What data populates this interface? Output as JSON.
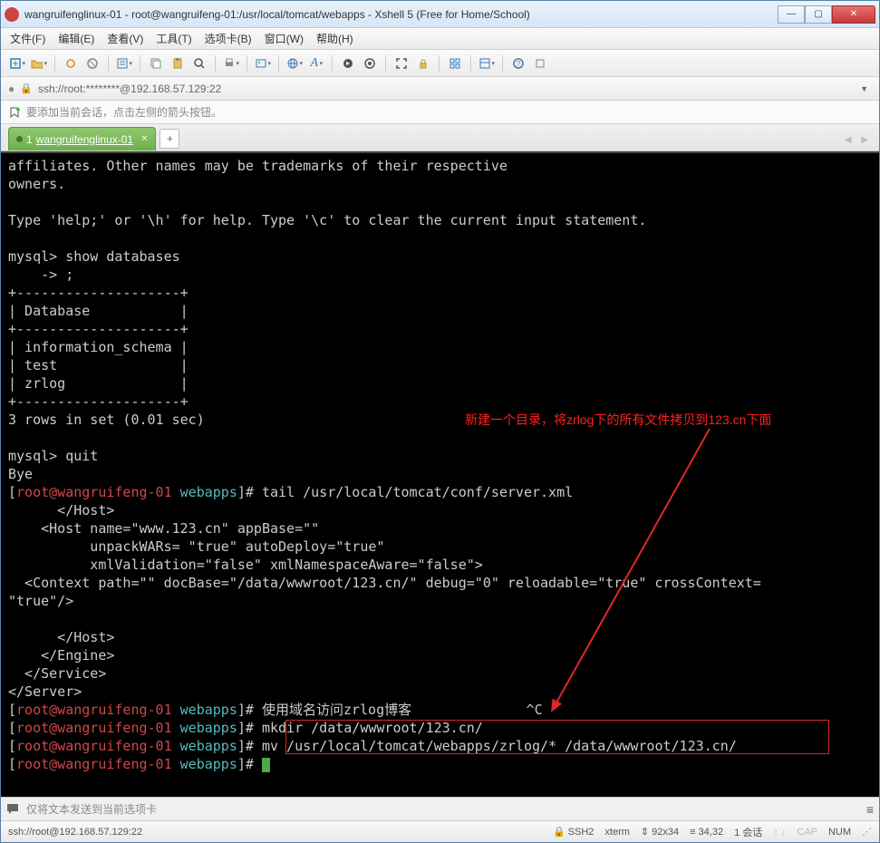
{
  "window": {
    "title": "wangruifenglinux-01 - root@wangruifeng-01:/usr/local/tomcat/webapps - Xshell 5 (Free for Home/School)"
  },
  "menu": {
    "file": "文件(F)",
    "edit": "编辑(E)",
    "view": "查看(V)",
    "tools": "工具(T)",
    "tabs": "选项卡(B)",
    "window": "窗口(W)",
    "help": "帮助(H)"
  },
  "addressbar": {
    "url": "ssh://root:********@192.168.57.129:22"
  },
  "hint": {
    "text": "要添加当前会话，点击左侧的箭头按钮。"
  },
  "tab": {
    "index": "1",
    "label": "wangruifenglinux-01"
  },
  "terminal": {
    "lines": [
      "affiliates. Other names may be trademarks of their respective",
      "owners.",
      "",
      "Type 'help;' or '\\h' for help. Type '\\c' to clear the current input statement.",
      "",
      "mysql> show databases",
      "    -> ;",
      "+--------------------+",
      "| Database           |",
      "+--------------------+",
      "| information_schema |",
      "| test               |",
      "| zrlog              |",
      "+--------------------+",
      "3 rows in set (0.01 sec)",
      "",
      "mysql> quit",
      "Bye"
    ],
    "prompt_user": "root@wangruifeng-01",
    "prompt_dir": "webapps",
    "cmd1": "tail /usr/local/tomcat/conf/server.xml",
    "xml_lines": [
      "      </Host>",
      "    <Host name=\"www.123.cn\" appBase=\"\"",
      "          unpackWARs= \"true\" autoDeploy=\"true\"",
      "          xmlValidation=\"false\" xmlNamespaceAware=\"false\">",
      "  <Context path=\"\" docBase=\"/data/wwwroot/123.cn/\" debug=\"0\" reloadable=\"true\" crossContext=",
      "\"true\"/>",
      "",
      "      </Host>",
      "    </Engine>",
      "  </Service>",
      "</Server>"
    ],
    "cmd2": "使用域名访问zrlog博客              ^C",
    "cmd3": "mkdir /data/wwwroot/123.cn/",
    "cmd4": "mv /usr/local/tomcat/webapps/zrlog/* /data/wwwroot/123.cn/",
    "annotation": "新建一个目录，将zrlog下的所有文件拷贝到123.cn下面"
  },
  "sendbar": {
    "text": "仅将文本发送到当前选项卡"
  },
  "status": {
    "conn": "ssh://root@192.168.57.129:22",
    "proto": "SSH2",
    "term": "xterm",
    "size": "92x34",
    "pos": "34,32",
    "sessions": "1 会话",
    "caps": "CAP",
    "num": "NUM"
  }
}
